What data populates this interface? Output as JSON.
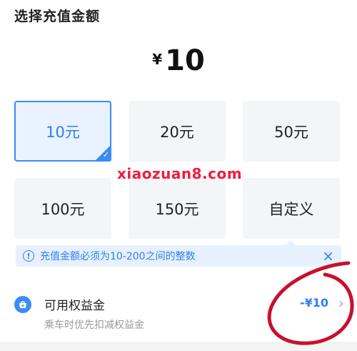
{
  "title": "选择充值金额",
  "amount": {
    "currency": "¥",
    "value": "10"
  },
  "options": [
    {
      "label": "10元",
      "selected": true
    },
    {
      "label": "20元",
      "selected": false
    },
    {
      "label": "50元",
      "selected": false
    },
    {
      "label": "100元",
      "selected": false
    },
    {
      "label": "150元",
      "selected": false
    },
    {
      "label": "自定义",
      "selected": false
    }
  ],
  "notice": {
    "text": "充值金额必须为10-200之间的整数",
    "close": "×"
  },
  "benefit": {
    "label": "可用权益金",
    "subtitle": "乘车时优先扣减权益金",
    "value": "-¥10"
  },
  "watermark": "xiaozuan8.com",
  "colors": {
    "accent": "#2f7ff0",
    "selected_bg": "#e8f3ff",
    "watermark": "#f01c3c",
    "annotation": "#c8102e"
  }
}
